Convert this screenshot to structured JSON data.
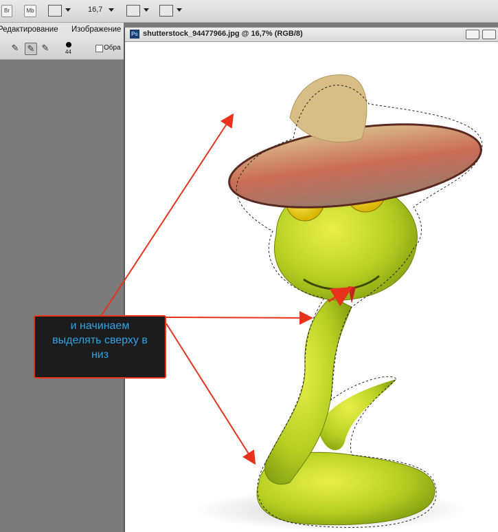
{
  "appbar": {
    "br_label": "Br",
    "mb_label": "Mb",
    "zoom_value": "16,7"
  },
  "menu": {
    "items": [
      "Редактирование",
      "Изображение"
    ]
  },
  "options": {
    "brush_size": "44",
    "checkbox_label": "Обра"
  },
  "document": {
    "ps_badge": "Ps",
    "title": "shutterstock_94477966.jpg @ 16,7% (RGB/8)"
  },
  "callout": {
    "lines": [
      "и начинаем",
      "выделять сверху в",
      "низ"
    ]
  },
  "colors": {
    "annotation": "#e8321e",
    "callout_text": "#2ea3e8"
  }
}
